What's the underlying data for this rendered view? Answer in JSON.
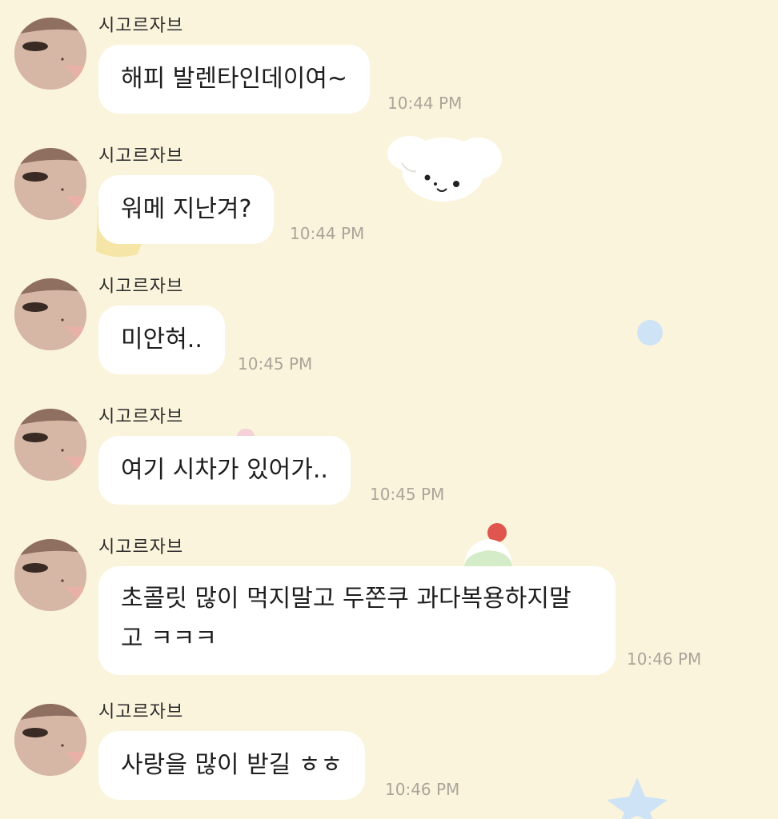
{
  "chat": {
    "messages": [
      {
        "sender": "시고르자브",
        "text": "해피 발렌타인데이여~",
        "time": "10:44 PM"
      },
      {
        "sender": "시고르자브",
        "text": "워메 지난겨?",
        "time": "10:44 PM"
      },
      {
        "sender": "시고르자브",
        "text": "미안혀..",
        "time": "10:45 PM"
      },
      {
        "sender": "시고르자브",
        "text": "여기 시차가 있어가..",
        "time": "10:45 PM"
      },
      {
        "sender": "시고르자브",
        "text": "초콜릿 많이 먹지말고 두쫀쿠 과다복용하지말고 ㅋㅋㅋ",
        "time": "10:46 PM"
      },
      {
        "sender": "시고르자브",
        "text": "사랑을 많이 받길 ㅎㅎ",
        "time": "10:46 PM"
      }
    ]
  },
  "theme": {
    "background": "#fbf4dc",
    "bubble": "#ffffff",
    "time_color": "#a9a59a"
  },
  "decorations": [
    "puppy-sticker",
    "cake-sticker",
    "blue-dot",
    "star-sticker"
  ]
}
